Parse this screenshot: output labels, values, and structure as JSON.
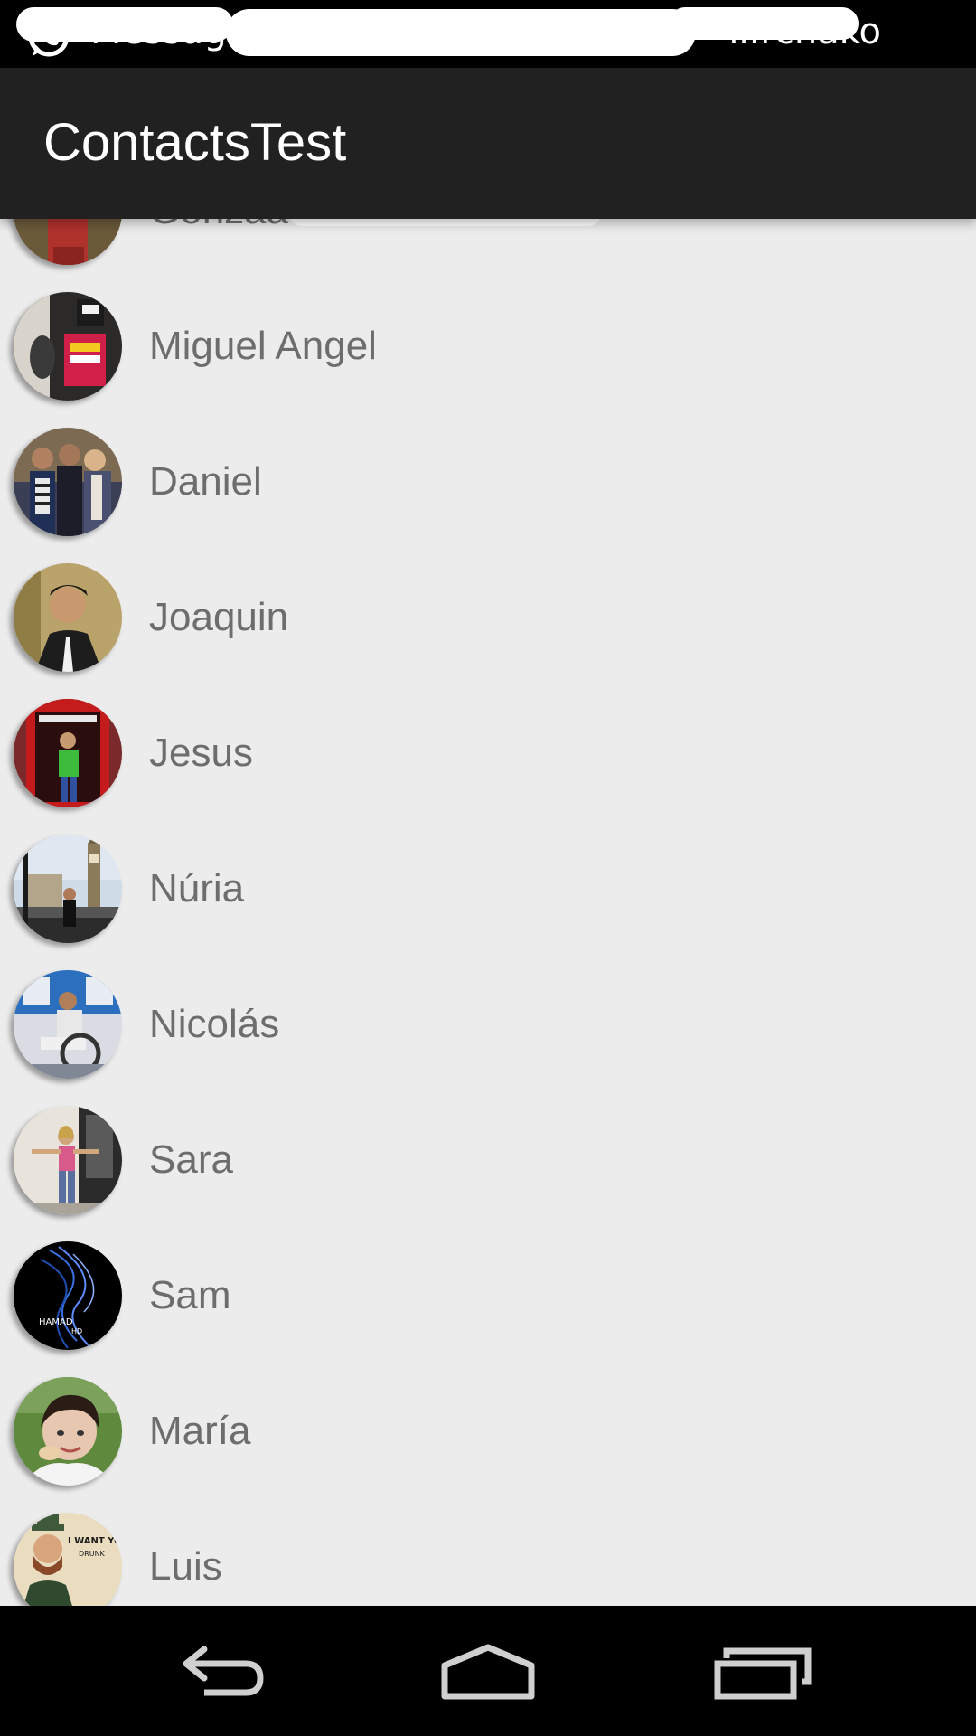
{
  "status_bar": {
    "notification_icon": "whatsapp-icon",
    "left_text": "Messag",
    "right_text": "ıl.rchako"
  },
  "action_bar": {
    "title": "ContactsTest"
  },
  "contacts": [
    {
      "name": "Gonzaa",
      "avatar": "person-photo-red"
    },
    {
      "name": "Miguel Angel",
      "avatar": "person-photo-tour"
    },
    {
      "name": "Daniel",
      "avatar": "group-photo"
    },
    {
      "name": "Joaquin",
      "avatar": "person-photo-portrait"
    },
    {
      "name": "Jesus",
      "avatar": "phone-booth-photo"
    },
    {
      "name": "Núria",
      "avatar": "big-ben-photo"
    },
    {
      "name": "Nicolás",
      "avatar": "wheelchair-photo"
    },
    {
      "name": "Sara",
      "avatar": "person-photo-standing"
    },
    {
      "name": "Sam",
      "avatar": "hamad-hd-logo"
    },
    {
      "name": "María",
      "avatar": "person-photo-smiling"
    },
    {
      "name": "Luis",
      "avatar": "i-want-you-drunk-poster"
    }
  ],
  "nav_bar": {
    "back_icon": "back-icon",
    "home_icon": "home-icon",
    "recents_icon": "recents-icon"
  },
  "avatar_logo_text": {
    "sam_line1": "HAMAD",
    "sam_line2": "HD",
    "luis_line1": "I WANT YOU",
    "luis_line2": "DRUNK"
  }
}
